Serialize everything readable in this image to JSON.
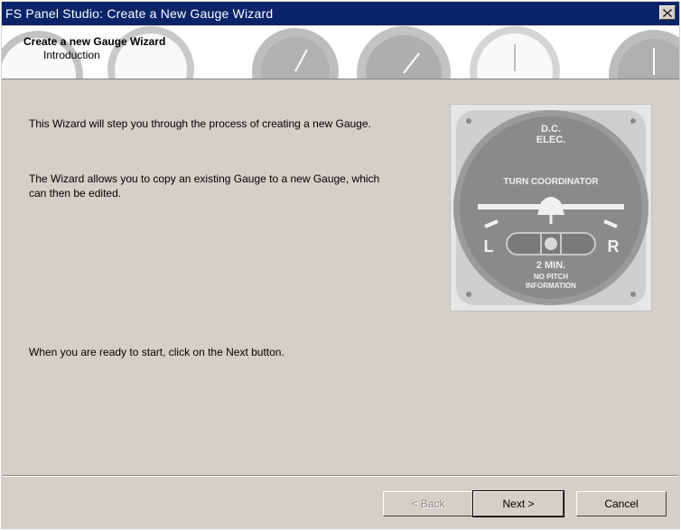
{
  "window": {
    "title": "FS Panel Studio: Create a New Gauge Wizard",
    "close_icon": "close-x-icon"
  },
  "header": {
    "title": "Create a new Gauge Wizard",
    "subtitle": "Introduction"
  },
  "body": {
    "paragraph1": "This Wizard will step you through the process of creating a new Gauge.",
    "paragraph2_line1": "The Wizard allows you to copy an existing Gauge to a new Gauge, which",
    "paragraph2_line2": "can then be edited.",
    "paragraph3": "When you are ready to start, click on the Next button."
  },
  "illustration": {
    "top_label_1": "D.C.",
    "top_label_2": "ELEC.",
    "band_label": "TURN COORDINATOR",
    "left_letter": "L",
    "right_letter": "R",
    "bottom_1": "2 MIN.",
    "bottom_2": "NO PITCH",
    "bottom_3": "INFORMATION"
  },
  "buttons": {
    "back": "< Back",
    "next": "Next >",
    "cancel": "Cancel"
  },
  "colors": {
    "titlebar": "#0a246a",
    "face": "#d4d0c8"
  }
}
